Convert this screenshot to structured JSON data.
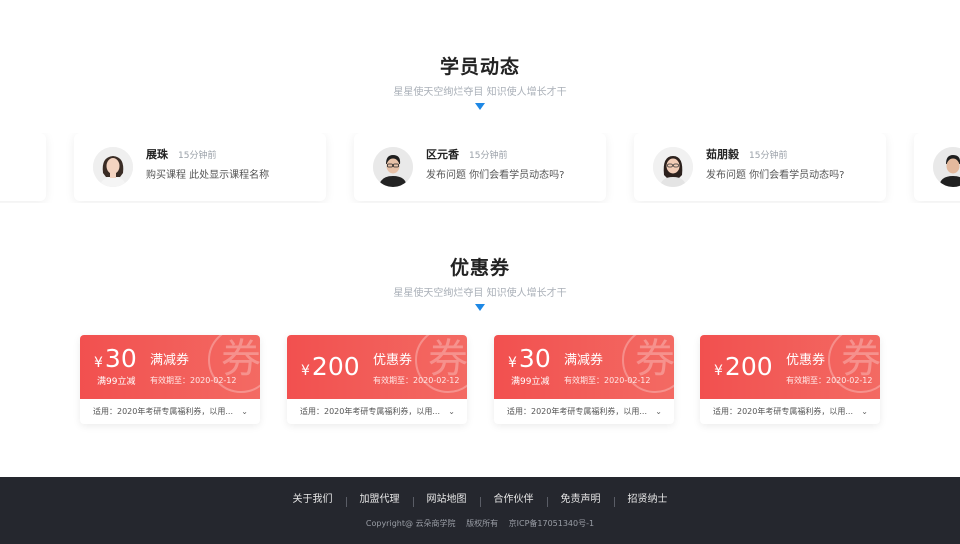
{
  "students_section": {
    "title": "学员动态",
    "subtitle": "星星使天空绚烂夺目  知识使人增长才干"
  },
  "activities": [
    {
      "name": "展珠",
      "time": "15分钟前",
      "text": "购买课程   此处显示课程名称"
    },
    {
      "name": "区元香",
      "time": "15分钟前",
      "text": "发布问题   你们会看学员动态吗?"
    },
    {
      "name": "茹朋毅",
      "time": "15分钟前",
      "text": "发布问题   你们会看学员动态吗?"
    }
  ],
  "coupons_section": {
    "title": "优惠券",
    "subtitle": "星星使天空绚烂夺目  知识使人增长才干"
  },
  "coupons": [
    {
      "currency": "¥",
      "amount": "30",
      "condition": "满99立减",
      "type": "满减券",
      "expire": "有效期至：2020-02-12",
      "desc": "适用：2020年考研专属福利券，以用...",
      "watermark": "券"
    },
    {
      "currency": "¥",
      "amount": "200",
      "condition": "",
      "type": "优惠券",
      "expire": "有效期至：2020-02-12",
      "desc": "适用：2020年考研专属福利券，以用...",
      "watermark": "券"
    },
    {
      "currency": "¥",
      "amount": "30",
      "condition": "满99立减",
      "type": "满减券",
      "expire": "有效期至：2020-02-12",
      "desc": "适用：2020年考研专属福利券，以用...",
      "watermark": "券"
    },
    {
      "currency": "¥",
      "amount": "200",
      "condition": "",
      "type": "优惠券",
      "expire": "有效期至：2020-02-12",
      "desc": "适用：2020年考研专属福利券，以用...",
      "watermark": "券"
    }
  ],
  "footer": {
    "links": [
      "关于我们",
      "加盟代理",
      "网站地图",
      "合作伙伴",
      "免责声明",
      "招贤纳士"
    ],
    "copyright": "Copyright@ 云朵商学院",
    "rights": "版权所有",
    "icp": "京ICP备17051340号-1"
  },
  "colors": {
    "accent": "#1e88e5",
    "coupon": "#f2504f",
    "footer_bg": "#25272e"
  },
  "icons": {
    "section_arrow": "triangle-down-icon",
    "coupon_expand": "chevron-down-icon"
  }
}
